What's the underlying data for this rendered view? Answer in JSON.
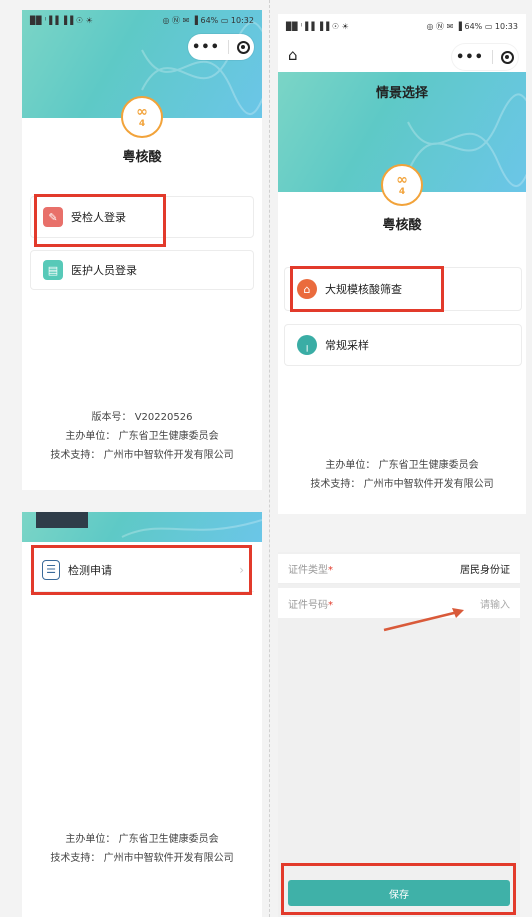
{
  "screen1": {
    "status_left": "▉▉ ˡ▐▐ ▐▐ ☉ ☀",
    "status_right": "◎ Ⓝ ✉ ▐ 64% ▭ 10:32",
    "capsule": {
      "more": "•••"
    },
    "logo_num": "4",
    "app_title": "粤核酸",
    "login_options": [
      {
        "label": "受检人登录",
        "icon": "form-icon",
        "color": "#e8706a"
      },
      {
        "label": "医护人员登录",
        "icon": "clipboard-icon",
        "color": "#57c9b8"
      }
    ],
    "footer": {
      "version": "版本号： V20220526",
      "organizer": "主办单位： 广东省卫生健康委员会",
      "support": "技术支持： 广州市中智软件开发有限公司"
    }
  },
  "screen2": {
    "status_left": "▉▉ ˡ▐▐ ▐▐ ☉ ☀",
    "status_right": "◎ Ⓝ ✉ ▐ 64% ▭ 10:33",
    "capsule": {
      "more": "•••"
    },
    "page_title": "情景选择",
    "logo_num": "4",
    "app_title": "粤核酸",
    "scenarios": [
      {
        "label": "大规模核酸筛查",
        "icon": "home-scan-icon",
        "color": "#ea6b3d"
      },
      {
        "label": "常规采样",
        "icon": "test-tube-icon",
        "color": "#3aada5"
      }
    ],
    "footer": {
      "organizer": "主办单位： 广东省卫生健康委员会",
      "support": "技术支持： 广州市中智软件开发有限公司"
    }
  },
  "screen3": {
    "menu_item": "检测申请",
    "footer": {
      "organizer": "主办单位： 广东省卫生健康委员会",
      "support": "技术支持： 广州市中智软件开发有限公司"
    }
  },
  "screen4": {
    "id_type_label": "证件类型",
    "id_type_value": "居民身份证",
    "id_number_label": "证件号码",
    "id_number_placeholder": "请输入",
    "required_mark": "*",
    "save_label": "保存"
  },
  "colors": {
    "accent": "#3fb1a8",
    "highlight": "#e23a2b",
    "logo": "#f2a33a"
  }
}
